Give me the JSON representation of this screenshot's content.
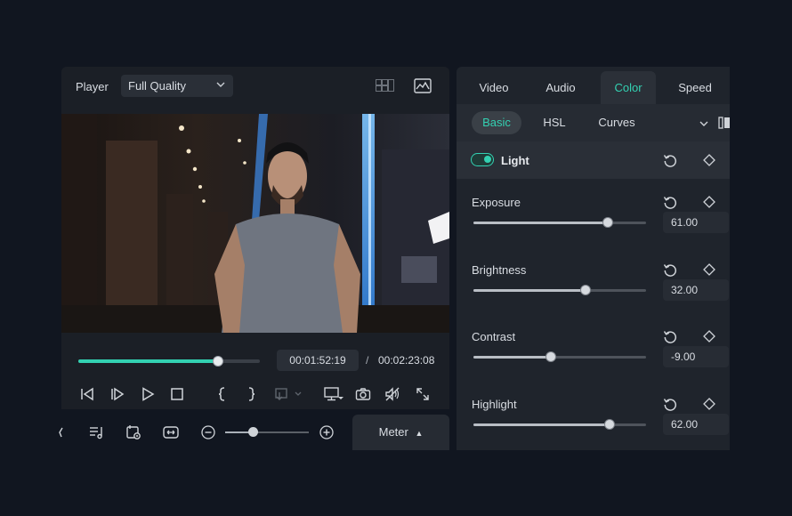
{
  "player": {
    "title": "Player",
    "quality": "Full Quality",
    "progress": 0.77,
    "current_time": "00:01:52:19",
    "separator": "/",
    "total_time": "00:02:23:08"
  },
  "bottom_toolbar": {
    "zoom_level": 0.33,
    "meter_label": "Meter"
  },
  "panel": {
    "tabs": [
      {
        "label": "Video",
        "active": false
      },
      {
        "label": "Audio",
        "active": false
      },
      {
        "label": "Color",
        "active": true
      },
      {
        "label": "Speed",
        "active": false
      }
    ],
    "subtabs": [
      {
        "label": "Basic",
        "active": true
      },
      {
        "label": "HSL",
        "active": false
      },
      {
        "label": "Curves",
        "active": false
      }
    ],
    "light": {
      "label": "Light",
      "enabled": true
    },
    "params": [
      {
        "label": "Exposure",
        "value": "61.00",
        "level": 0.78
      },
      {
        "label": "Brightness",
        "value": "32.00",
        "level": 0.65
      },
      {
        "label": "Contrast",
        "value": "-9.00",
        "level": 0.45
      },
      {
        "label": "Highlight",
        "value": "62.00",
        "level": 0.79
      }
    ]
  },
  "colors": {
    "accent": "#33d1b2",
    "background": "#111620",
    "panel": "#1f242c"
  }
}
